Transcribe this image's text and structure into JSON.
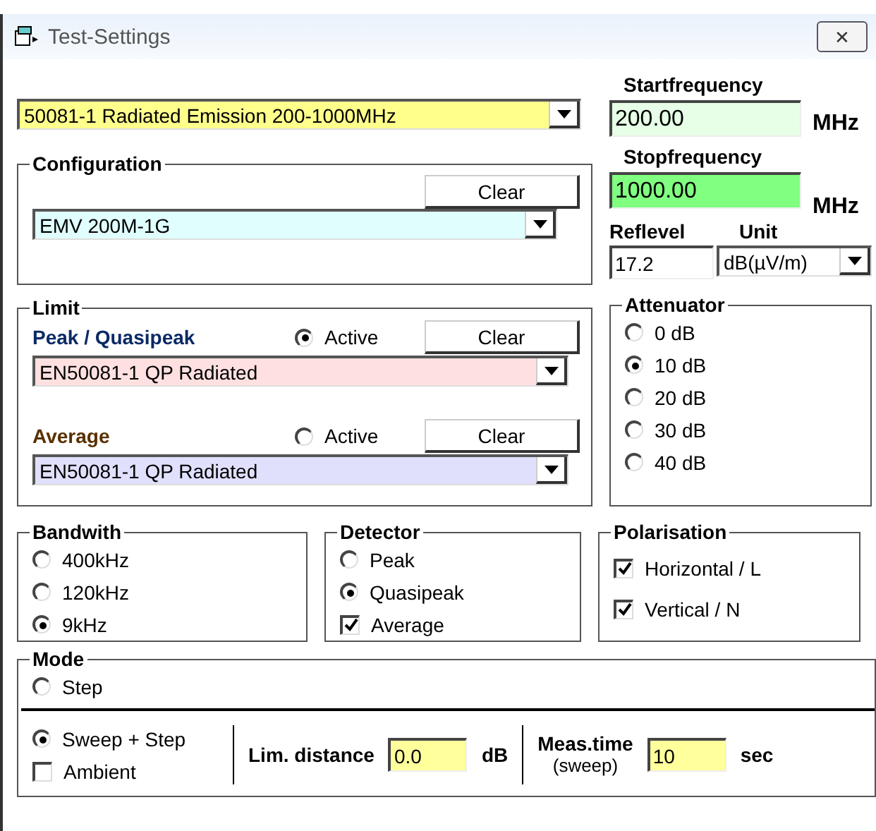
{
  "window": {
    "title": "Test-Settings",
    "close": "✕"
  },
  "test_select": {
    "value": "50081-1 Radiated Emission 200-1000MHz"
  },
  "configuration": {
    "title": "Configuration",
    "clear": "Clear",
    "value": "EMV 200M-1G"
  },
  "limit": {
    "title": "Limit",
    "rows": [
      {
        "label": "Peak / Quasipeak",
        "active_label": "Active",
        "selected": true,
        "clear": "Clear",
        "value": "EN50081-1 QP Radiated"
      },
      {
        "label": "Average",
        "active_label": "Active",
        "selected": false,
        "clear": "Clear",
        "value": "EN50081-1 QP Radiated"
      }
    ]
  },
  "start": {
    "label": "Startfrequency",
    "value": "200.00",
    "unit": "MHz"
  },
  "stop": {
    "label": "Stopfrequency",
    "value": "1000.00",
    "unit": "MHz"
  },
  "reflevel": {
    "label": "Reflevel",
    "value": "17.2"
  },
  "unit": {
    "label": "Unit",
    "value": "dB(µV/m)"
  },
  "attenuator": {
    "title": "Attenuator",
    "options": [
      {
        "label": "0 dB",
        "selected": false
      },
      {
        "label": "10 dB",
        "selected": true
      },
      {
        "label": "20 dB",
        "selected": false
      },
      {
        "label": "30 dB",
        "selected": false
      },
      {
        "label": "40 dB",
        "selected": false
      }
    ]
  },
  "bandwidth": {
    "title": "Bandwith",
    "options": [
      {
        "label": "400kHz",
        "selected": false
      },
      {
        "label": "120kHz",
        "selected": false
      },
      {
        "label": "9kHz",
        "selected": true
      }
    ]
  },
  "detector": {
    "title": "Detector",
    "items": [
      {
        "kind": "radio",
        "label": "Peak",
        "selected": false
      },
      {
        "kind": "radio",
        "label": "Quasipeak",
        "selected": true
      },
      {
        "kind": "checkbox",
        "label": "Average",
        "checked": true
      }
    ]
  },
  "polarisation": {
    "title": "Polarisation",
    "items": [
      {
        "label": "Horizontal / L",
        "checked": true
      },
      {
        "label": "Vertical / N",
        "checked": true
      }
    ]
  },
  "mode": {
    "title": "Mode",
    "options": [
      {
        "label": "Step",
        "selected": false
      },
      {
        "label": "Sweep + Step",
        "selected": true
      }
    ],
    "ambient": {
      "label": "Ambient",
      "checked": false
    },
    "lim_distance": {
      "label": "Lim. distance",
      "value": "0.0",
      "unit": "dB"
    },
    "meas_time": {
      "label": "Meas.time",
      "sublabel": "(sweep)",
      "value": "10",
      "unit": "sec"
    }
  }
}
